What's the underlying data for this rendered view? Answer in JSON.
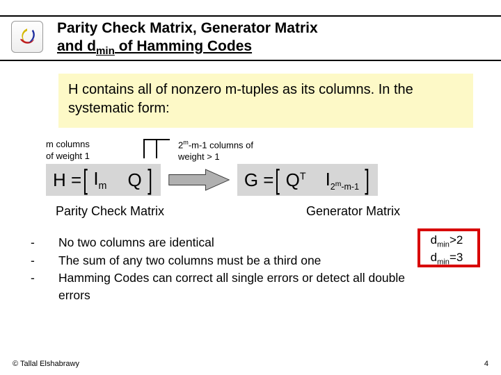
{
  "header": {
    "title_line1": "Parity Check Matrix, Generator Matrix",
    "title_line2_pre": "and d",
    "title_line2_sub": "min",
    "title_line2_post": " of Hamming Codes"
  },
  "intro": "H contains all of nonzero m-tuples as its columns. In the systematic form:",
  "annot": {
    "left_l1": "m columns",
    "left_l2": "of weight 1",
    "right_l1_pre": "2",
    "right_l1_sup": "m",
    "right_l1_post": "-m-1 columns of",
    "right_l2": "weight > 1"
  },
  "matrices": {
    "H_label": "H = ",
    "H_I": "I",
    "H_I_sub": "m",
    "H_Q": "Q",
    "G_label": "G = ",
    "G_Q": "Q",
    "G_Q_sup": "T",
    "G_I": "I",
    "G_I_sub": "2",
    "G_I_sub_sup": "m",
    "G_I_sub_post": "-m-1"
  },
  "labels": {
    "parity": "Parity Check Matrix",
    "generator": "Generator Matrix"
  },
  "bullets": [
    "No two columns are identical",
    "The sum of any two columns must be a third one",
    "Hamming Codes can correct all single errors or detect all double errors"
  ],
  "dmin": {
    "l1_pre": "d",
    "l1_sub": "min",
    "l1_post": ">2",
    "l2_pre": "d",
    "l2_sub": "min",
    "l2_post": "=3"
  },
  "footer": {
    "copyright": "© Tallal Elshabrawy",
    "page": "4"
  }
}
